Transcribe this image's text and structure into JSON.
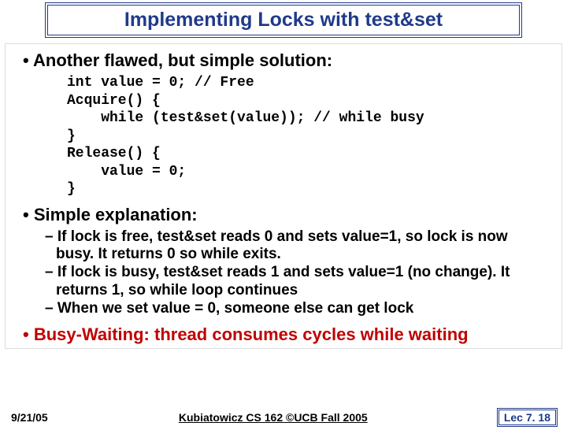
{
  "title": "Implementing Locks with test&set",
  "bullet_another": "• Another flawed, but simple solution:",
  "code": "int value = 0; // Free\nAcquire() {\n    while (test&set(value)); // while busy\n}\nRelease() {\n    value = 0;\n}",
  "bullet_simple": "• Simple explanation:",
  "sub1": "– If lock is free, test&set reads 0 and sets value=1, so lock is now busy.  It returns 0 so while exits.",
  "sub2": "– If lock is busy, test&set reads 1 and sets value=1 (no change). It returns 1, so while loop continues",
  "sub3": "– When we set value = 0, someone else can get lock",
  "bullet_busy": "• Busy-Waiting: thread consumes cycles while waiting",
  "footer": {
    "date": "9/21/05",
    "center": "Kubiatowicz CS 162 ©UCB Fall 2005",
    "right": "Lec 7. 18"
  }
}
